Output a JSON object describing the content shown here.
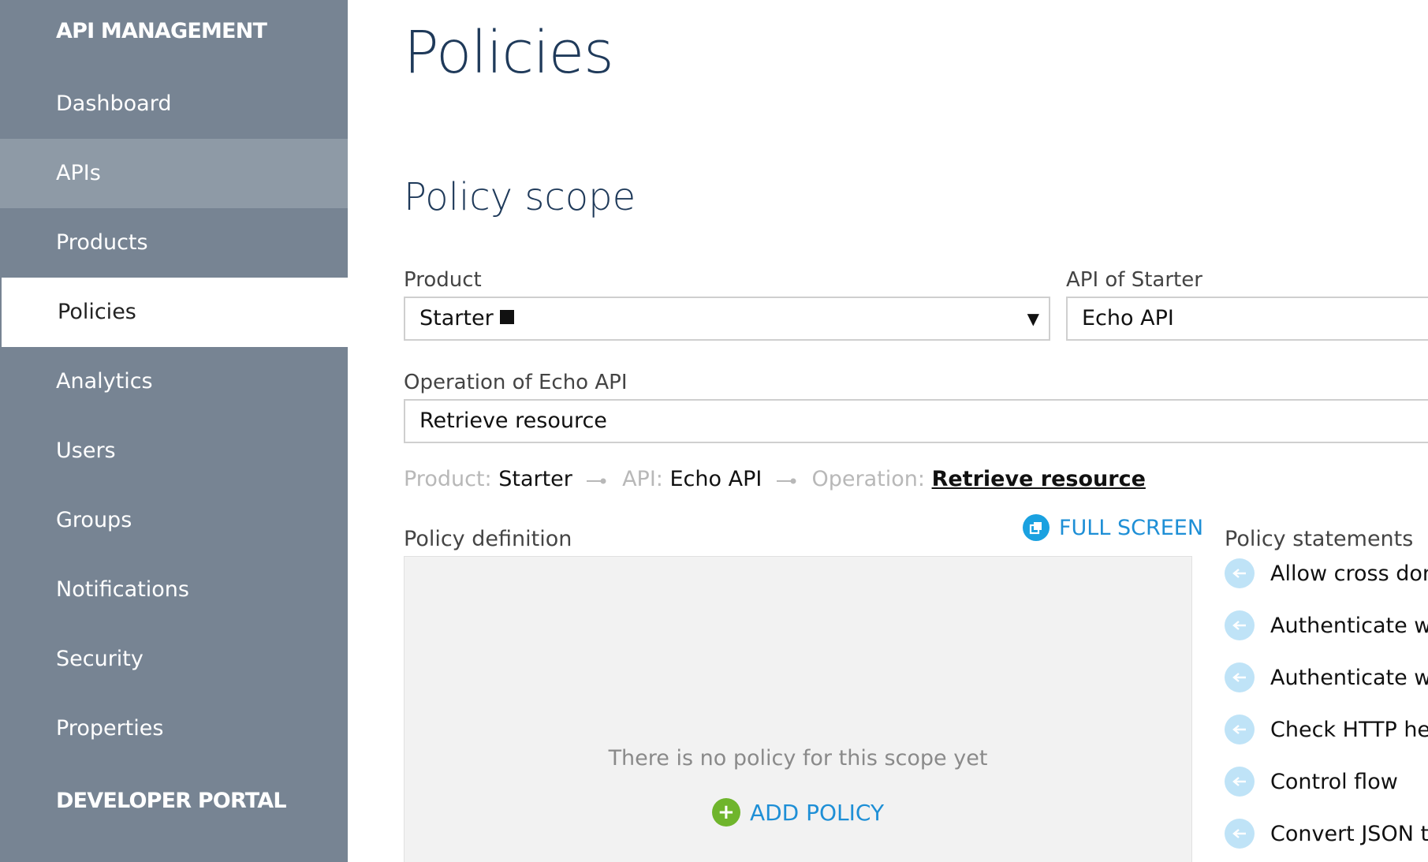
{
  "sidebar": {
    "section_api": "API MANAGEMENT",
    "items": [
      {
        "label": "Dashboard"
      },
      {
        "label": "APIs"
      },
      {
        "label": "Products"
      },
      {
        "label": "Policies"
      },
      {
        "label": "Analytics"
      },
      {
        "label": "Users"
      },
      {
        "label": "Groups"
      },
      {
        "label": "Notifications"
      },
      {
        "label": "Security"
      },
      {
        "label": "Properties"
      }
    ],
    "section_portal": "DEVELOPER PORTAL"
  },
  "main": {
    "title": "Policies",
    "scope_heading": "Policy scope",
    "product_label": "Product",
    "product_value": "Starter",
    "api_label": "API of Starter",
    "api_value": "Echo API",
    "operation_label": "Operation of Echo API",
    "operation_value": "Retrieve resource",
    "breadcrumb": {
      "product_label": "Product:",
      "product_value": "Starter",
      "api_label": "API:",
      "api_value": "Echo API",
      "operation_label": "Operation:",
      "operation_value": "Retrieve resource"
    },
    "policy_definition_label": "Policy definition",
    "full_screen": "FULL SCREEN",
    "empty_text": "There is no policy for this scope yet",
    "add_policy": "ADD POLICY",
    "statements_label": "Policy statements",
    "statements": [
      {
        "label": "Allow cross dom"
      },
      {
        "label": "Authenticate wit"
      },
      {
        "label": "Authenticate wit"
      },
      {
        "label": "Check HTTP hea"
      },
      {
        "label": "Control flow"
      },
      {
        "label": "Convert JSON to"
      }
    ]
  },
  "colors": {
    "sidebar_bg": "#778493",
    "sidebar_hover": "#8e9aa6",
    "accent": "#1e8fd6",
    "title": "#1f3a5a",
    "add_green": "#6fb52c"
  },
  "icons": {
    "fullscreen": "fullscreen-icon",
    "add": "plus-icon",
    "statement": "arrow-left-icon",
    "breadcrumb_separator": "connector-arrow-icon",
    "dropdown": "caret-down-icon"
  }
}
